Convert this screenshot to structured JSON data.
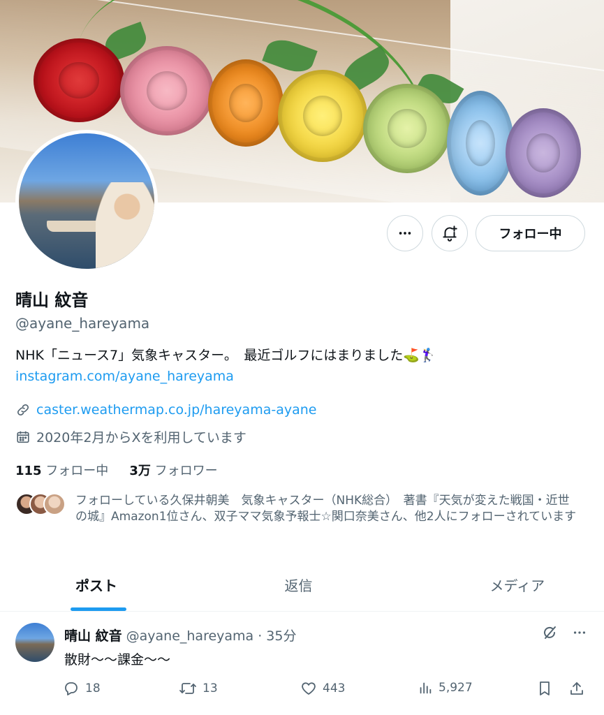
{
  "profile": {
    "display_name": "晴山 紋音",
    "handle": "@ayane_hareyama",
    "bio": "NHK「ニュース7」気象キャスター。　最近ゴルフにはまりました⛳️🏌️‍♀️",
    "bio_link": "instagram.com/ayane_hareyama",
    "website": "caster.weathermap.co.jp/hareyama-ayane",
    "joined": "2020年2月からXを利用しています",
    "following_count": "115",
    "following_label": "フォロー中",
    "followers_count": "3万",
    "followers_label": "フォロワー",
    "followers_you_know": "フォローしている久保井朝美　気象キャスター（NHK総合）　著書『天気が変えた戦国・近世の城』Amazon1位さん、双子ママ気象予報士☆関口奈美さん、他2人にフォローされています"
  },
  "actions": {
    "follow_button": "フォロー中",
    "more_icon": "more-horizontal-icon",
    "notify_icon": "bell-plus-icon"
  },
  "tabs": [
    {
      "label": "ポスト",
      "active": true
    },
    {
      "label": "返信",
      "active": false
    },
    {
      "label": "メディア",
      "active": false
    }
  ],
  "tweet": {
    "name": "晴山 紋音",
    "handle": "@ayane_hareyama",
    "time": "· 35分",
    "text": "散財〜〜課金〜〜",
    "replies": "18",
    "reposts": "13",
    "likes": "443",
    "views": "5,927"
  },
  "colors": {
    "accent": "#1d9bf0",
    "text": "#0f1419",
    "secondary": "#536471"
  }
}
